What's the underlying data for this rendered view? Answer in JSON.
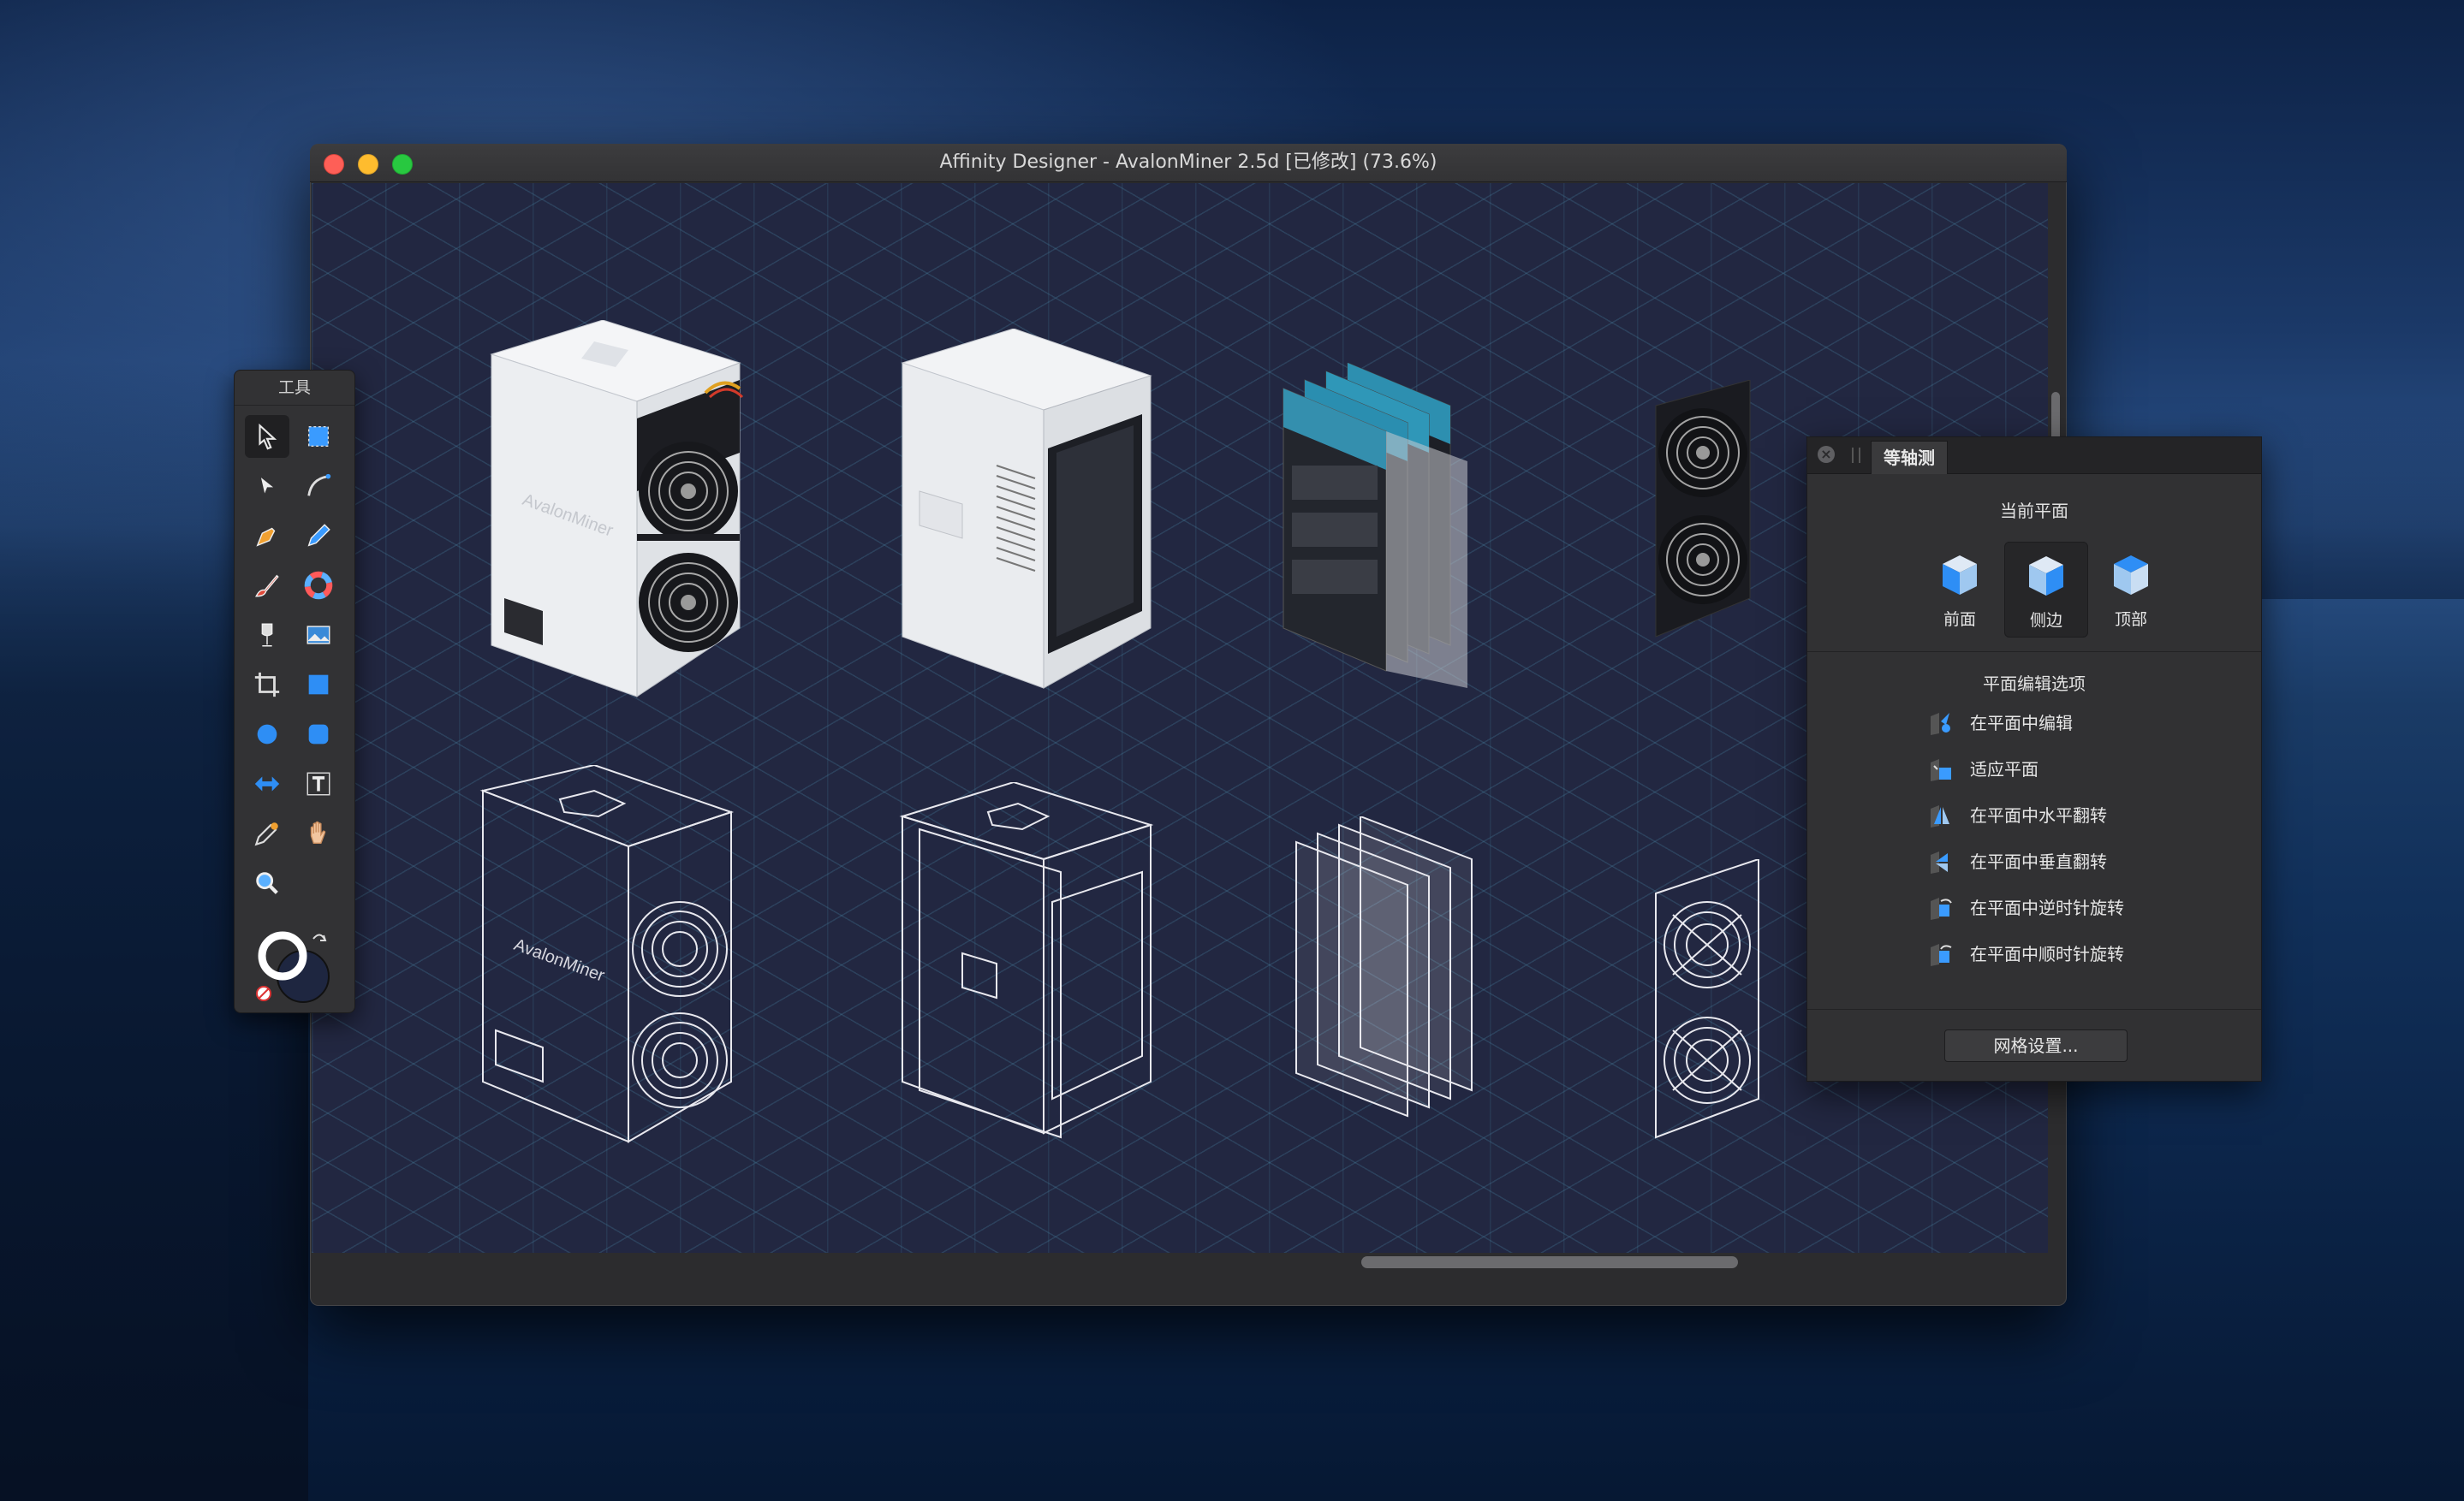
{
  "window": {
    "title": "Affinity Designer - AvalonMiner 2.5d [已修改] (73.6%)"
  },
  "tools_panel": {
    "title": "工具"
  },
  "artwork": {
    "brand_label": "AvalonMiner"
  },
  "isometric_panel": {
    "tab_label": "等轴测",
    "current_plane_label": "当前平面",
    "planes": [
      {
        "label": "前面",
        "active": false
      },
      {
        "label": "侧边",
        "active": true
      },
      {
        "label": "顶部",
        "active": false
      }
    ],
    "edit_options_label": "平面编辑选项",
    "options": [
      {
        "label": "在平面中编辑",
        "icon": "edit-in-plane-icon"
      },
      {
        "label": "适应平面",
        "icon": "fit-to-plane-icon"
      },
      {
        "label": "在平面中水平翻转",
        "icon": "flip-horizontal-icon"
      },
      {
        "label": "在平面中垂直翻转",
        "icon": "flip-vertical-icon"
      },
      {
        "label": "在平面中逆时针旋转",
        "icon": "rotate-ccw-icon"
      },
      {
        "label": "在平面中顺时针旋转",
        "icon": "rotate-cw-icon"
      }
    ],
    "grid_settings_button": "网格设置..."
  },
  "colors": {
    "canvas_bg": "#222741",
    "grid_line": "#4682a0",
    "accent_blue": "#3a9bff",
    "panel_bg": "#313133"
  }
}
